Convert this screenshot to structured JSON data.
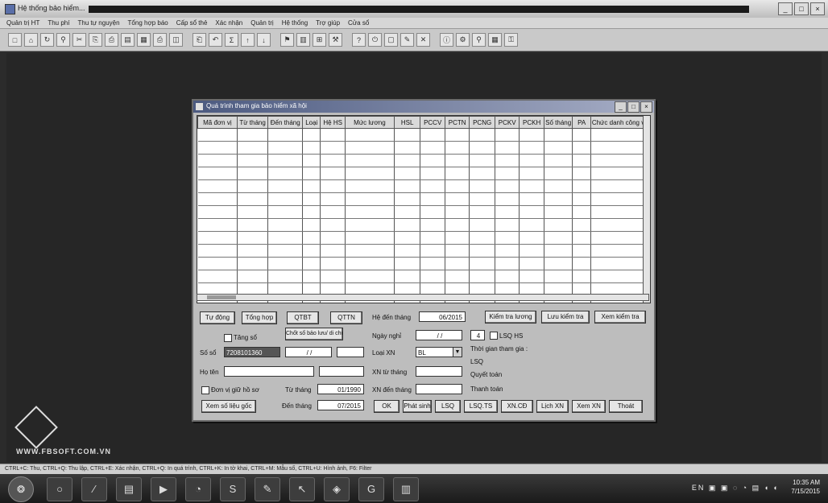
{
  "window": {
    "title": "Hệ thống bảo hiểm..."
  },
  "menu": [
    "Quản trị HT",
    "Thu phí",
    "Thu tự nguyện",
    "Tổng hợp báo",
    "Cấp sổ thẻ",
    "Xác nhận",
    "Quản trị",
    "Hệ thống",
    "Trợ giúp",
    "Cửa sổ"
  ],
  "toolbar": {
    "icons": [
      "new-icon",
      "open-icon",
      "refresh-icon",
      "find-icon",
      "cut-icon",
      "copy-icon",
      "paste-icon",
      "doc-icon",
      "sheet-icon",
      "print-icon",
      "preview-icon",
      "save-icon",
      "undo-icon",
      "sum-icon",
      "sort-asc-icon",
      "sort-desc-icon",
      "filter-icon",
      "chart-icon",
      "calc-icon",
      "tool-icon",
      "help-icon",
      "exit-icon",
      "page-icon",
      "edit-icon",
      "delete-icon",
      "info-icon",
      "settings-icon",
      "search-icon",
      "table-icon",
      "lock-icon"
    ]
  },
  "dialog": {
    "title": "Quá trình tham gia bảo hiểm xã hội",
    "columns": [
      "Mã đơn vị",
      "Từ tháng",
      "Đến tháng",
      "Loại",
      "Hệ HS",
      "Mức lương",
      "HSL",
      "PCCV",
      "PCTN",
      "PCNG",
      "PCKV",
      "PCKH",
      "Số tháng",
      "PA",
      "Chức danh công việc"
    ],
    "row_count": 15,
    "buttons": {
      "tu_dong": "Tự động",
      "tong_hop": "Tổng hợp",
      "qtbt": "QTBT",
      "qttn": "QTTN",
      "chot_so": "Chốt số bảo lưu/ di chuyển",
      "kiem_tra_luong": "Kiểm tra lương",
      "luu_kiem_tra": "Lưu kiểm tra",
      "xem_kiem_tra": "Xem kiểm tra",
      "xem_so_lieu_goc": "Xem số liệu gốc",
      "ok": "OK",
      "phat_sinh": "Phát sinh",
      "lsq": "LSQ",
      "lsq_ts": "LSQ.TS",
      "xn_cd": "XN.CĐ",
      "lich_xn": "Lịch XN",
      "xem_xn": "Xem XN",
      "thoat": "Thoát"
    },
    "fields": {
      "tang_so_label": "Tăng sổ",
      "so_so_label": "Số sổ",
      "so_so_value": "7208101360",
      "date_blank": "/ /",
      "ho_ten_label": "Họ tên",
      "don_vi_chk": "Đơn vị giữ hồ sơ",
      "tu_thang_label": "Từ tháng",
      "tu_thang_value": "01/1990",
      "den_thang_label": "Đến tháng",
      "den_thang_value": "07/2015",
      "hs_den_thang_label": "Hệ đến tháng",
      "hs_den_thang_value": "06/2015",
      "ngay_nghi_label": "Ngày nghỉ",
      "ngay_nghi_value": "/ /",
      "num_value": "4",
      "lsq_hs": "LSQ HS",
      "loai_xn_label": "Loại XN",
      "loai_xn_value": "BL",
      "xn_tu_thang_label": "XN từ tháng",
      "xn_den_thang_label": "XN đến tháng",
      "tg_tham_gia": "Thời gian tham gia :",
      "lsq_info": "LSQ",
      "quyet_toan": "Quyết toán",
      "thanh_toan": "Thanh toán"
    }
  },
  "logo_url": "WWW.FBSOFT.COM.VN",
  "statusbar": "CTRL+C: Thu, CTRL+Q: Thu lập, CTRL+E: Xác nhận, CTRL+Q: In quá trình, CTRL+K: In tờ khai, CTRL+M: Mẫu số, CTRL+U: Hình ảnh, F6: Filter",
  "taskbar": {
    "apps": [
      "○",
      "⁄",
      "▤",
      "▶",
      "◔",
      "S",
      "✎",
      "↖",
      "◈",
      "G",
      "▥"
    ],
    "tray": "EN ▣ ▣ ◌ ◔ ▤ ◖ ◐",
    "time": "10:35 AM",
    "date": "7/15/2015"
  }
}
